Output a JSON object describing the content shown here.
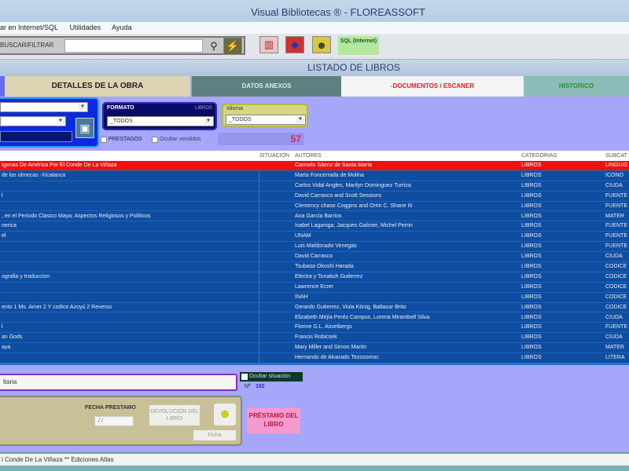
{
  "window": {
    "title": "Visual Bibliotecas ®  - FLOREASSOFT"
  },
  "menu": [
    "ar en Internet/SQL",
    "Utilidades",
    "Ayuda"
  ],
  "toolbar": {
    "search_label": "BUSCAR/FILTRAR",
    "search_value": "",
    "sql_label": "SQL (Internet)"
  },
  "header": {
    "title": "LISTADO DE LIBROS"
  },
  "tabs": [
    {
      "label": "DETALLES DE LA OBRA"
    },
    {
      "label": "DATOS ANEXOS"
    },
    {
      "label": "-DOCUMENTOS / ESCANER"
    },
    {
      "label": "HISTORICO"
    }
  ],
  "filters": {
    "formato_label": "FORMATO",
    "formato_type": "LIBROS",
    "formato_value": "_TODOS",
    "idioma_label": "Idioma",
    "idioma_value": "_TODOS",
    "prestados_label": "PRESTADOS",
    "ocultar_vendidos_label": "Ocultar vendidos",
    "count": "57"
  },
  "table": {
    "columns": [
      "",
      "SITUACIÓN",
      "AUTORES",
      "CATEGORIAS",
      "SUBCAT"
    ],
    "rows": [
      [
        "ígenas De América Por El Conde De La Viñaza",
        "",
        "Carmelo Sáenz de Santa María",
        "LIBROS",
        "LINGUIS"
      ],
      [
        " de los olmecas -Xicalanca",
        "",
        "Marta Foncerrada de Molina",
        "LIBROS",
        "ICONO"
      ],
      [
        "",
        "",
        "Carlos Vidal Angles, Marilyn Dominguez Turriza",
        "LIBROS",
        "CIUDA"
      ],
      [
        "l",
        "",
        "David Carrasco and Scott Sessions",
        "LIBROS",
        "FUENTE"
      ],
      [
        "",
        "",
        "Clemency chase Coggins and Orrin C. Shane III",
        "LIBROS",
        "FUENTE"
      ],
      [
        ", en el Periodo Clasico Maya: Aspectos Religiosos y Políticos",
        "",
        "Ana García Barrios",
        "LIBROS",
        "MATER"
      ],
      [
        "nerica",
        "",
        "Isabel Laganiga, Jacques Galinier, Michel Perrin",
        "LIBROS",
        "FUENTE"
      ],
      [
        "el",
        "",
        "UNAM",
        "LIBROS",
        "FUENTE"
      ],
      [
        "",
        "",
        "Luis Maldonado Venegas",
        "LIBROS",
        "FUENTE"
      ],
      [
        "",
        "",
        "David Carrasco",
        "LIBROS",
        "CIUDA"
      ],
      [
        "",
        "",
        "Tsubasa Okoshi Harada",
        "LIBROS",
        "CODICE"
      ],
      [
        "ografia y traduccion",
        "",
        "Electra y Tonatiuh Gutierrez",
        "LIBROS",
        "CODICE"
      ],
      [
        "",
        "",
        "Lawrence Ecrer",
        "LIBROS",
        "CODICE"
      ],
      [
        "",
        "",
        "INAH",
        "LIBROS",
        "CODICE"
      ],
      [
        "ento 1 Ms. Amer 2 Y codice Azoyú 2 Reverso",
        "",
        "Gerardo Gutierrez, Viola König, Baltazar Brito",
        "LIBROS",
        "CODICE"
      ],
      [
        "",
        "",
        "Elizabeth Mejía Peréz Campus, Lorena Mirambell Silva",
        "LIBROS",
        "CIUDA"
      ],
      [
        "l",
        "",
        "Florine G.L. Asselbergs",
        "LIBROS",
        "FUENTE"
      ],
      [
        "an Gods",
        "",
        "Francis Robicsek",
        "LIBROS",
        "CIUDA"
      ],
      [
        "aya",
        "",
        "Mary Miller and Simon Martin",
        "LIBROS",
        "MATER"
      ],
      [
        "",
        "",
        "Hernando de Alvarado Tezozomoc",
        "LIBROS",
        "LITERA"
      ]
    ]
  },
  "bottom": {
    "field_value": "ltaria",
    "ocultar_situacion_label": "Ocultar situación",
    "numero_label": "Nº",
    "numero_value": "192",
    "fecha_prestamo_label": "FECHA PRESTAMO",
    "fecha_value": "/ /",
    "devolucion_label": "DEVOLUCIÓN DEL LIBRO",
    "ficha_label": "Ficha",
    "prestamo_label": "PRÉSTAMO DEL LIBRO"
  },
  "status": {
    "text": "l Conde De La Viñaza ** Ediciones Atlas"
  }
}
